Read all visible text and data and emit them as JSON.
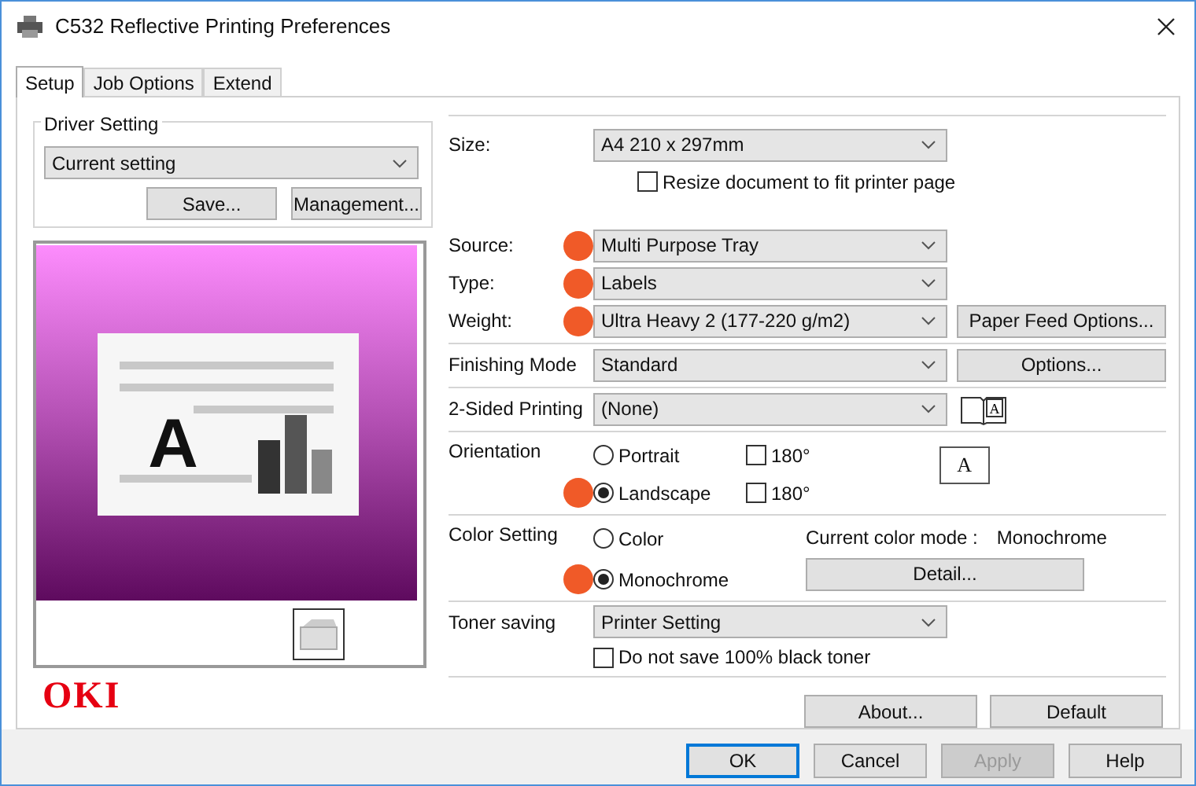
{
  "window": {
    "title": "C532 Reflective Printing Preferences"
  },
  "tabs": [
    {
      "label": "Setup",
      "selected": true
    },
    {
      "label": "Job Options",
      "selected": false
    },
    {
      "label": "Extend",
      "selected": false
    }
  ],
  "driver_setting": {
    "label": "Driver Setting",
    "value": "Current setting",
    "buttons": [
      "Save...",
      "Management..."
    ]
  },
  "preview": {
    "letter": "A"
  },
  "logo": "OKI",
  "size": {
    "label": "Size:",
    "value": "A4 210 x 297mm",
    "resize": {
      "label": "Resize document to fit printer page",
      "checked": false
    }
  },
  "paper": [
    {
      "label": "Source:",
      "value": "Multi Purpose Tray",
      "marked": true
    },
    {
      "label": "Type:",
      "value": "Labels",
      "marked": true
    },
    {
      "label": "Weight:",
      "value": "Ultra Heavy 2 (177-220 g/m2)",
      "marked": true
    }
  ],
  "paper_feed_button": "Paper Feed Options...",
  "finishing": {
    "label": "Finishing Mode",
    "value": "Standard",
    "button": "Options..."
  },
  "duplex": {
    "label": "2-Sided Printing",
    "value": "(None)",
    "icon_letter": "A"
  },
  "orientation": {
    "label": "Orientation",
    "icon_letter": "A",
    "options": [
      {
        "label": "Portrait",
        "selected": false,
        "marked": false,
        "rotate": {
          "label": "180°",
          "checked": false
        }
      },
      {
        "label": "Landscape",
        "selected": true,
        "marked": true,
        "rotate": {
          "label": "180°",
          "checked": false
        }
      }
    ]
  },
  "color_setting": {
    "label": "Color Setting",
    "mode_label": "Current color mode :",
    "mode_value": "Monochrome",
    "detail_button": "Detail...",
    "options": [
      {
        "label": "Color",
        "selected": false,
        "marked": false
      },
      {
        "label": "Monochrome",
        "selected": true,
        "marked": true
      }
    ]
  },
  "toner": {
    "label": "Toner saving",
    "value": "Printer Setting",
    "black": {
      "label": "Do not save 100% black toner",
      "checked": false
    }
  },
  "panel_buttons": [
    "About...",
    "Default"
  ],
  "dialog_buttons": [
    {
      "label": "OK",
      "default": true,
      "disabled": false
    },
    {
      "label": "Cancel",
      "default": false,
      "disabled": false
    },
    {
      "label": "Apply",
      "default": false,
      "disabled": true
    },
    {
      "label": "Help",
      "default": false,
      "disabled": false
    }
  ]
}
